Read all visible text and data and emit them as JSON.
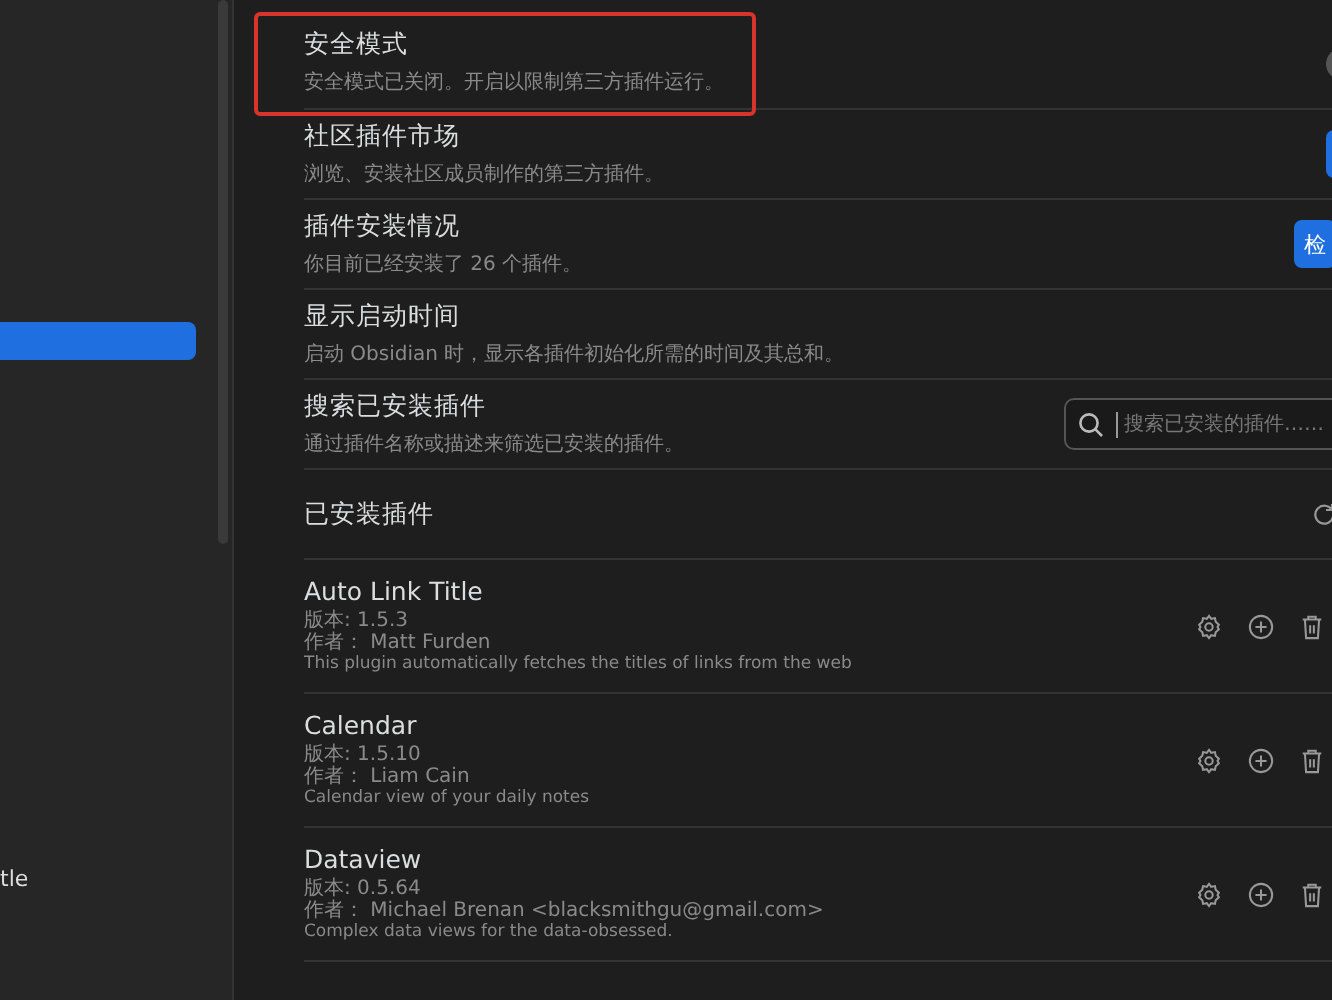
{
  "sidebar": {
    "items": [
      {
        "selected": true
      },
      {
        "label": "tle",
        "selected": false
      }
    ]
  },
  "settings": [
    {
      "kind": "toggle",
      "title": "安全模式",
      "description": "安全模式已关闭。开启以限制第三方插件运行。",
      "highlighted": true,
      "on": false
    },
    {
      "kind": "button",
      "title": "社区插件市场",
      "description": "浏览、安装社区成员制作的第三方插件。",
      "highlighted": false
    },
    {
      "kind": "button",
      "title": "插件安装情况",
      "description": "你目前已经安装了 26 个插件。",
      "highlighted": false,
      "button": "检"
    },
    {
      "kind": "plain",
      "title": "显示启动时间",
      "description": "启动 Obsidian 时，显示各插件初始化所需的时间及其总和。",
      "highlighted": false
    },
    {
      "kind": "search",
      "title": "搜索已安装插件",
      "description": "通过插件名称或描述来筛选已安装的插件。",
      "highlighted": false,
      "placeholder": "搜索已安装的插件……"
    }
  ],
  "installed": {
    "heading": "已安装插件",
    "plugins": [
      {
        "name": "Auto Link Title",
        "version": "版本: 1.5.3",
        "author": "作者： Matt Furden",
        "description": "This plugin automatically fetches the titles of links from the web"
      },
      {
        "name": "Calendar",
        "version": "版本: 1.5.10",
        "author": "作者： Liam Cain",
        "description": "Calendar view of your daily notes"
      },
      {
        "name": "Dataview",
        "version": "版本: 0.5.64",
        "author": "作者： Michael Brenan <blacksmithgu@gmail.com>",
        "description": "Complex data views for the data-obsessed."
      }
    ]
  }
}
